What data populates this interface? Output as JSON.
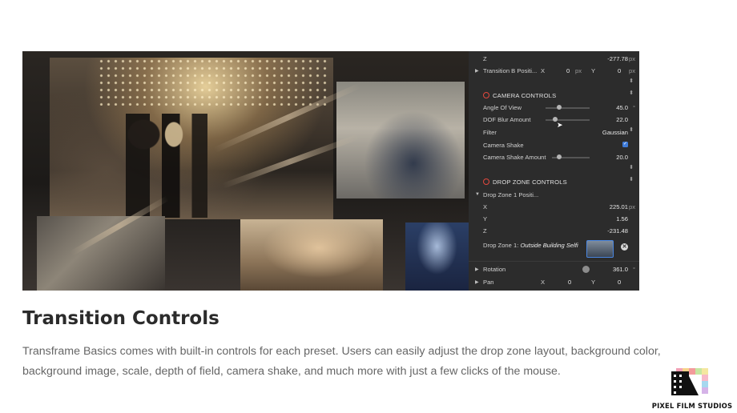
{
  "panel": {
    "rows": {
      "z1": {
        "label": "Z",
        "value": "-277.78",
        "unit": "px"
      },
      "transition_b": {
        "label": "Transition B Positi...",
        "x_label": "X",
        "x_value": "0",
        "x_unit": "px",
        "y_label": "Y",
        "y_value": "0",
        "y_unit": "px"
      },
      "camera_section": "CAMERA CONTROLS",
      "angle_of_view": {
        "label": "Angle Of View",
        "value": "45.0",
        "level": 0.3
      },
      "dof_blur": {
        "label": "DOF Blur Amount",
        "value": "22.0",
        "level": 0.22
      },
      "filter": {
        "label": "Filter",
        "value": "Gaussian"
      },
      "camera_shake": {
        "label": "Camera Shake",
        "checked": true
      },
      "camera_shake_amount": {
        "label": "Camera Shake Amount",
        "value": "20.0",
        "level": 0.2
      },
      "drop_zone_section": "DROP ZONE CONTROLS",
      "drop_zone_1_pos": {
        "label": "Drop Zone 1 Positi..."
      },
      "dz_x": {
        "label": "X",
        "value": "225.01",
        "unit": "px"
      },
      "dz_y": {
        "label": "Y",
        "value": "1.56"
      },
      "dz_z": {
        "label": "Z",
        "value": "-231.48"
      },
      "drop_zone_1": {
        "label": "Drop Zone 1:",
        "media": "Outside Building Selfi"
      },
      "rotation": {
        "label": "Rotation",
        "value": "361.0"
      },
      "pan": {
        "label": "Pan",
        "x_label": "X",
        "x_value": "0",
        "y_label": "Y",
        "y_value": "0"
      }
    },
    "colors": {
      "section_icon": "#e2483e",
      "accent": "#3f7bd8",
      "panel_bg": "#2c2c2c"
    }
  },
  "content": {
    "title": "Transition Controls",
    "body": "Transframe Basics comes with built-in controls for each preset. Users can easily adjust the drop zone layout, background color, background image, scale, depth of field, camera shake, and much more with just a few clicks of the mouse."
  },
  "brand": {
    "name": "PIXEL FILM STUDIOS"
  }
}
